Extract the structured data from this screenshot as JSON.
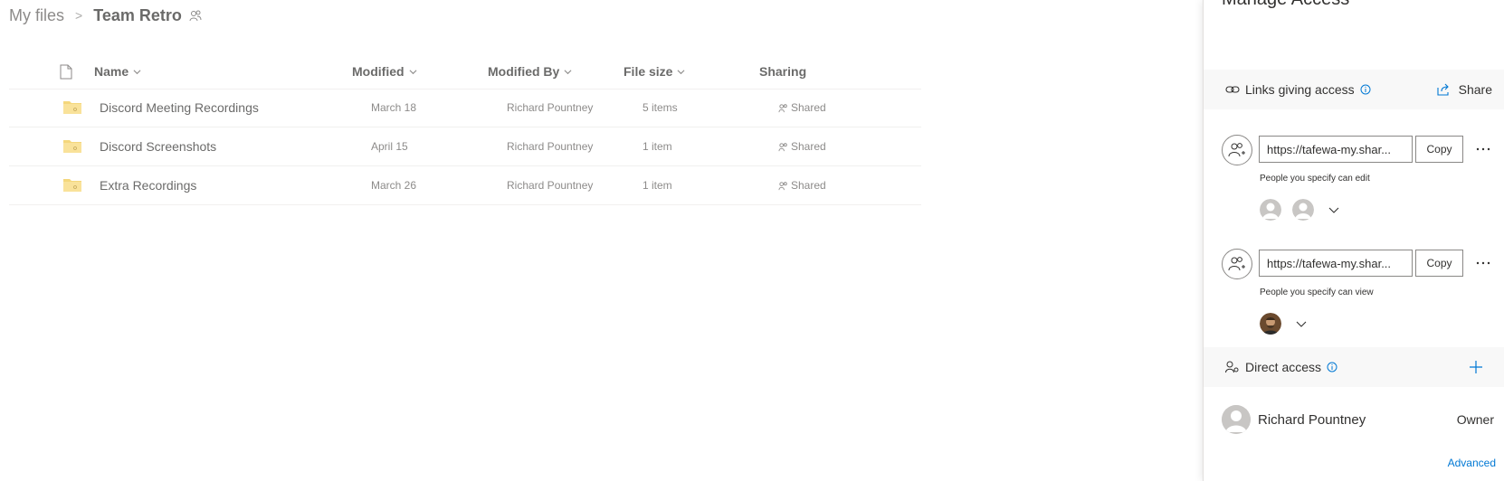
{
  "breadcrumb": {
    "root": "My files",
    "current": "Team Retro"
  },
  "columns": {
    "name": "Name",
    "modified": "Modified",
    "modified_by": "Modified By",
    "file_size": "File size",
    "sharing": "Sharing"
  },
  "files": [
    {
      "name": "Discord Meeting Recordings",
      "modified": "March 18",
      "modified_by": "Richard Pountney",
      "size": "5 items",
      "sharing": "Shared"
    },
    {
      "name": "Discord Screenshots",
      "modified": "April 15",
      "modified_by": "Richard Pountney",
      "size": "1 item",
      "sharing": "Shared"
    },
    {
      "name": "Extra Recordings",
      "modified": "March 26",
      "modified_by": "Richard Pountney",
      "size": "1 item",
      "sharing": "Shared"
    }
  ],
  "panel": {
    "title": "Manage Access",
    "links_label": "Links giving access",
    "share_label": "Share",
    "links": [
      {
        "url": "https://tafewa-my.shar...",
        "copy": "Copy",
        "permission": "People you specify can edit"
      },
      {
        "url": "https://tafewa-my.shar...",
        "copy": "Copy",
        "permission": "People you specify can view"
      }
    ],
    "direct_label": "Direct access",
    "owner": {
      "name": "Richard Pountney",
      "role": "Owner"
    },
    "advanced": "Advanced"
  },
  "colors": {
    "accent": "#0078d4",
    "folder": "#f0c84a",
    "band": "#f8f8f8"
  }
}
